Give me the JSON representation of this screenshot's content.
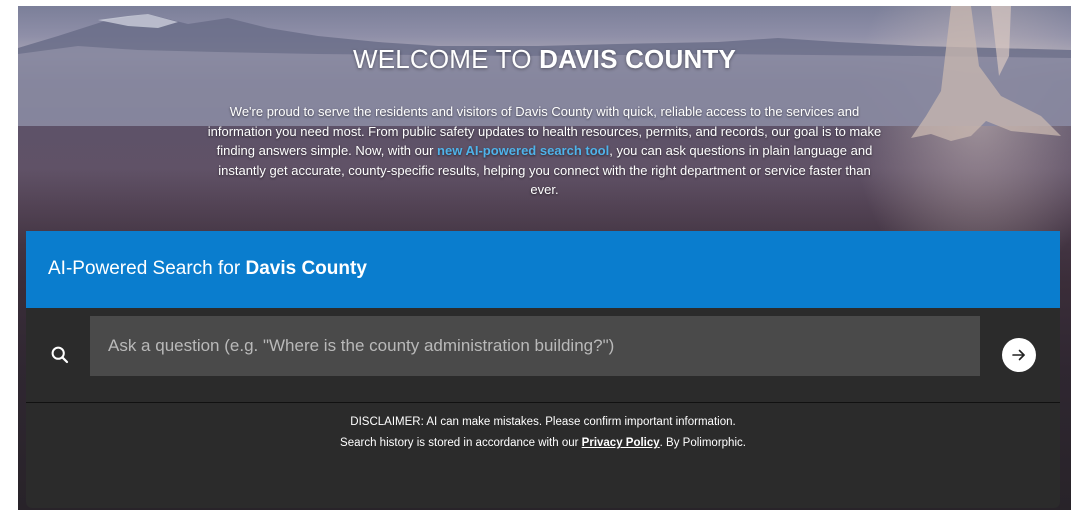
{
  "hero": {
    "title_prefix": "WELCOME TO ",
    "title_emphasis": "DAVIS COUNTY",
    "intro_before_link": "We're proud to serve the residents and visitors of Davis County with quick, reliable access to the services and information you need most. From public safety updates to health resources, permits, and records, our goal is to make finding answers simple. Now, with our ",
    "intro_link": "new AI-powered search tool",
    "intro_after_link": ", you can ask questions in plain language and instantly get accurate, county-specific results, helping you connect with the right department or service faster than ever."
  },
  "search_panel": {
    "title_prefix": "AI-Powered Search for ",
    "title_emphasis": "Davis County",
    "search_icon": "search-icon",
    "input_placeholder": "Ask a question (e.g. \"Where is the county administration building?\")",
    "input_value": "",
    "submit_icon": "arrow-right-icon",
    "disclaimer_line1": "DISCLAIMER: AI can make mistakes. Please confirm important information.",
    "disclaimer_line2_before": "Search history is stored in accordance with our ",
    "privacy_link": "Privacy Policy",
    "disclaimer_line2_after": ". By Polimorphic."
  },
  "colors": {
    "header_blue": "#0a7dce",
    "panel_dark": "#2b2b2b",
    "input_bg": "#4a4a4a",
    "link_blue": "#4fb3ea"
  }
}
